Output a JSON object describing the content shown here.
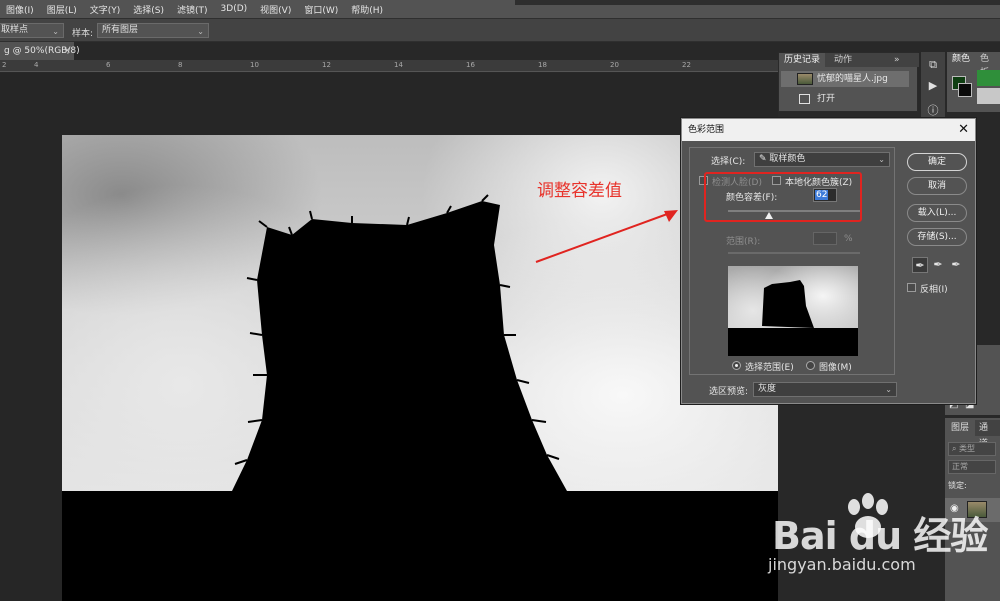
{
  "menubar": {
    "items": [
      "图像(I)",
      "图层(L)",
      "文字(Y)",
      "选择(S)",
      "滤镜(T)",
      "3D(D)",
      "视图(V)",
      "窗口(W)",
      "帮助(H)"
    ]
  },
  "options": {
    "sample_size_value": "取样点",
    "sample_label": "样本:",
    "sample_value": "所有图层"
  },
  "document": {
    "tab_label": "g @ 50%(RGB/8)",
    "close_glyph": "×",
    "ruler_ticks": [
      "2",
      "4",
      "6",
      "8",
      "10",
      "12",
      "14",
      "16",
      "18",
      "20",
      "22"
    ]
  },
  "history_panel": {
    "tab_history": "历史记录",
    "tab_actions": "动作",
    "expand_glyph": "»",
    "items": [
      {
        "label": "忧郁的喵星人.jpg"
      },
      {
        "label": "打开"
      }
    ]
  },
  "color_panel": {
    "tab_color": "颜色",
    "tab_swatches": "色板",
    "foreground_color": "#0f3e12",
    "background_color": "#0a0a0a",
    "swatch_colors": [
      "#2f8f3a",
      "#1f5fbf",
      "#d03030",
      "#c8c8c8"
    ]
  },
  "layers_panel": {
    "tab_layers": "图层",
    "tab_channels": "通道",
    "filter_placeholder": "类型",
    "blend_mode": "正常",
    "lock_label": "锁定:"
  },
  "dialog": {
    "title": "色彩范围",
    "close_glyph": "✕",
    "select_label": "选择(C):",
    "select_value": "取样颜色",
    "detect_faces_label": "检测人脸(D)",
    "localized_label": "本地化颜色簇(Z)",
    "fuzziness_label": "颜色容差(F):",
    "fuzziness_value": "62",
    "range_label": "范围(R):",
    "range_unit": "%",
    "radio_selection": "选择范围(E)",
    "radio_image": "图像(M)",
    "preview_label": "选区预览:",
    "preview_value": "灰度",
    "buttons": {
      "ok": "确定",
      "cancel": "取消",
      "load": "载入(L)...",
      "save": "存储(S)..."
    },
    "invert_label": "反相(I)",
    "fuzziness_fraction": 0.31
  },
  "annotation": {
    "text": "调整容差值",
    "color": "#e8332b"
  },
  "watermark": {
    "brand": "Bai du 经验",
    "url": "jingyan.baidu.com"
  }
}
